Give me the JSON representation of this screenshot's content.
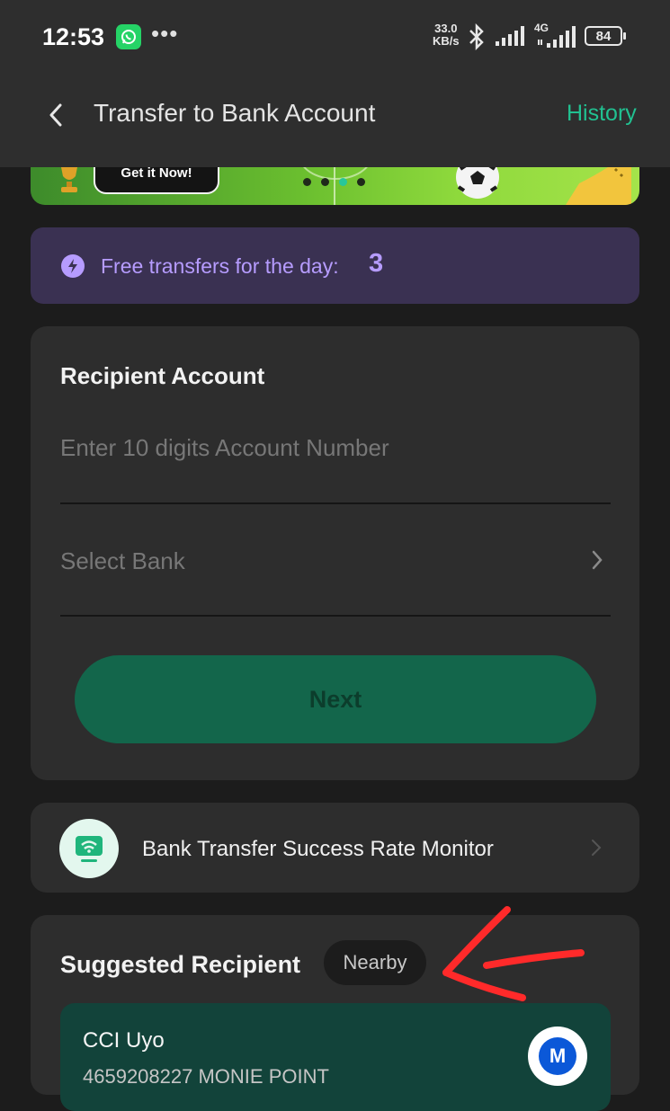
{
  "status_bar": {
    "time": "12:53",
    "net_speed_value": "33.0",
    "net_speed_unit": "KB/s",
    "network_type": "4G",
    "battery": "84",
    "icons": [
      "whatsapp-icon",
      "more-dots-icon",
      "bluetooth-icon",
      "signal-icon",
      "signal-4g-icon",
      "battery-icon"
    ]
  },
  "header": {
    "title": "Transfer to Bank Account",
    "history_label": "History"
  },
  "banner": {
    "cta_label": "Get it Now!",
    "carousel_dots": 4,
    "active_dot": 3
  },
  "free_transfers": {
    "label": "Free transfers for the day:",
    "count": "3"
  },
  "recipient_account": {
    "title": "Recipient Account",
    "account_placeholder": "Enter 10 digits Account Number",
    "account_value": "",
    "bank_placeholder": "Select Bank",
    "next_label": "Next"
  },
  "monitor": {
    "label": "Bank Transfer Success Rate Monitor"
  },
  "suggested": {
    "title": "Suggested Recipient",
    "badge": "Nearby",
    "items": [
      {
        "name": "CCI Uyo",
        "detail": "4659208227 MONIE POINT",
        "logo_letter": "M"
      }
    ]
  },
  "colors": {
    "accent": "#21c191",
    "next_button": "#13664b",
    "free_text": "#b69cff",
    "free_bg": "#3a3152",
    "annotation": "#ff2a2a"
  }
}
